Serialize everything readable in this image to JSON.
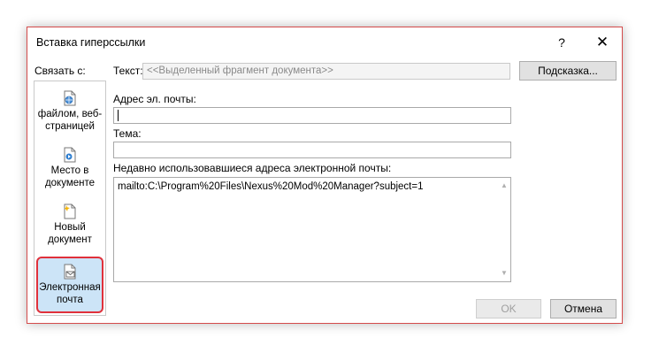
{
  "dialog": {
    "title": "Вставка гиперссылки",
    "help_label": "?",
    "close_label": "✕"
  },
  "link_to": {
    "label": "Связать с:",
    "items": [
      {
        "label": "файлом, веб-страницей",
        "icon": "globe-file-icon"
      },
      {
        "label": "Место в документе",
        "icon": "bookmark-document-icon"
      },
      {
        "label": "Новый документ",
        "icon": "new-document-icon"
      },
      {
        "label": "Электронная почта",
        "icon": "email-icon",
        "selected": true
      }
    ]
  },
  "text_field": {
    "label": "Текст:",
    "value": "<<Выделенный фрагмент документа>>"
  },
  "tooltip_button": "Подсказка...",
  "email_field": {
    "label": "Адрес эл. почты:",
    "value": ""
  },
  "subject_field": {
    "label": "Тема:",
    "value": ""
  },
  "recent": {
    "label": "Недавно использовавшиеся адреса электронной почты:",
    "items": [
      "mailto:C:\\Program%20Files\\Nexus%20Mod%20Manager?subject=1"
    ]
  },
  "buttons": {
    "ok": "OK",
    "cancel": "Отмена"
  },
  "colors": {
    "selection_bg": "#cce4f7",
    "highlight_border": "#e0313b",
    "frame_border": "#d44b4b"
  }
}
